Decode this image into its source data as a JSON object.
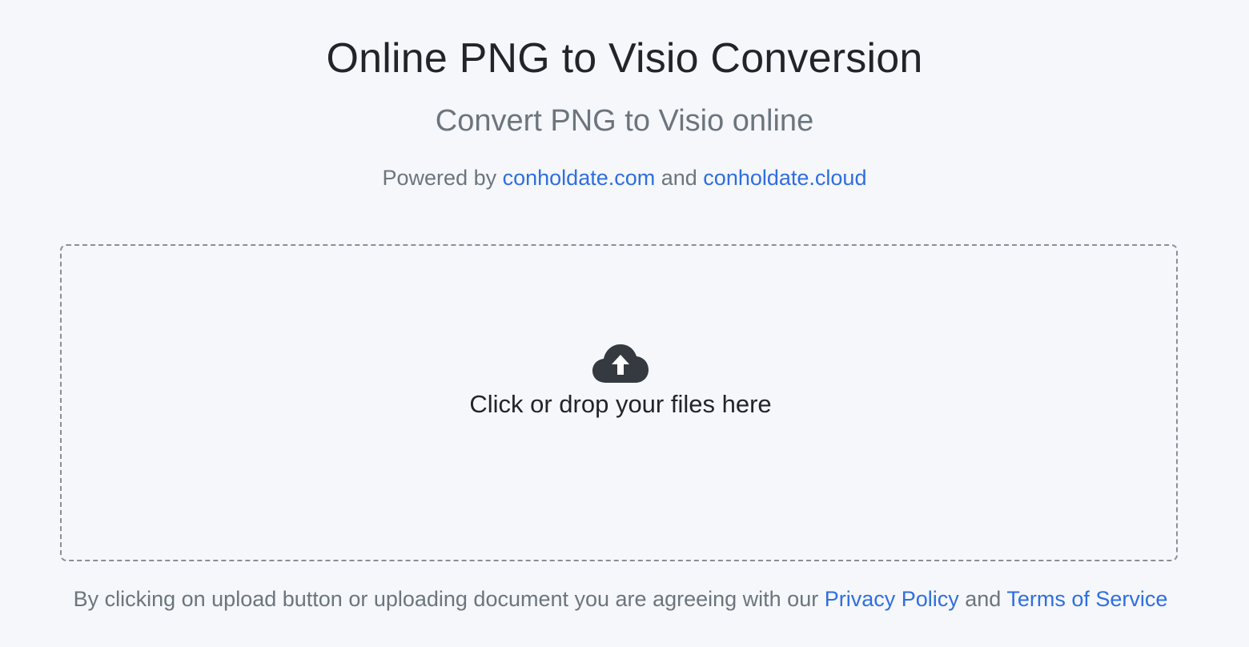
{
  "header": {
    "title": "Online PNG to Visio Conversion",
    "subtitle": "Convert PNG to Visio online",
    "powered_prefix": "Powered by ",
    "powered_link1": "conholdate.com",
    "powered_mid": " and ",
    "powered_link2": "conholdate.cloud"
  },
  "upload": {
    "icon": "cloud-upload-icon",
    "prompt": "Click or drop your files here"
  },
  "footer": {
    "consent_prefix": "By clicking on upload button or uploading document you are agreeing with our ",
    "privacy_link": "Privacy Policy",
    "consent_mid": " and ",
    "terms_link": "Terms of Service"
  },
  "colors": {
    "background": "#f5f7fb",
    "link": "#2f6ee0",
    "muted_text": "#6c757d",
    "dark_text": "#212529",
    "icon": "#343a40"
  }
}
